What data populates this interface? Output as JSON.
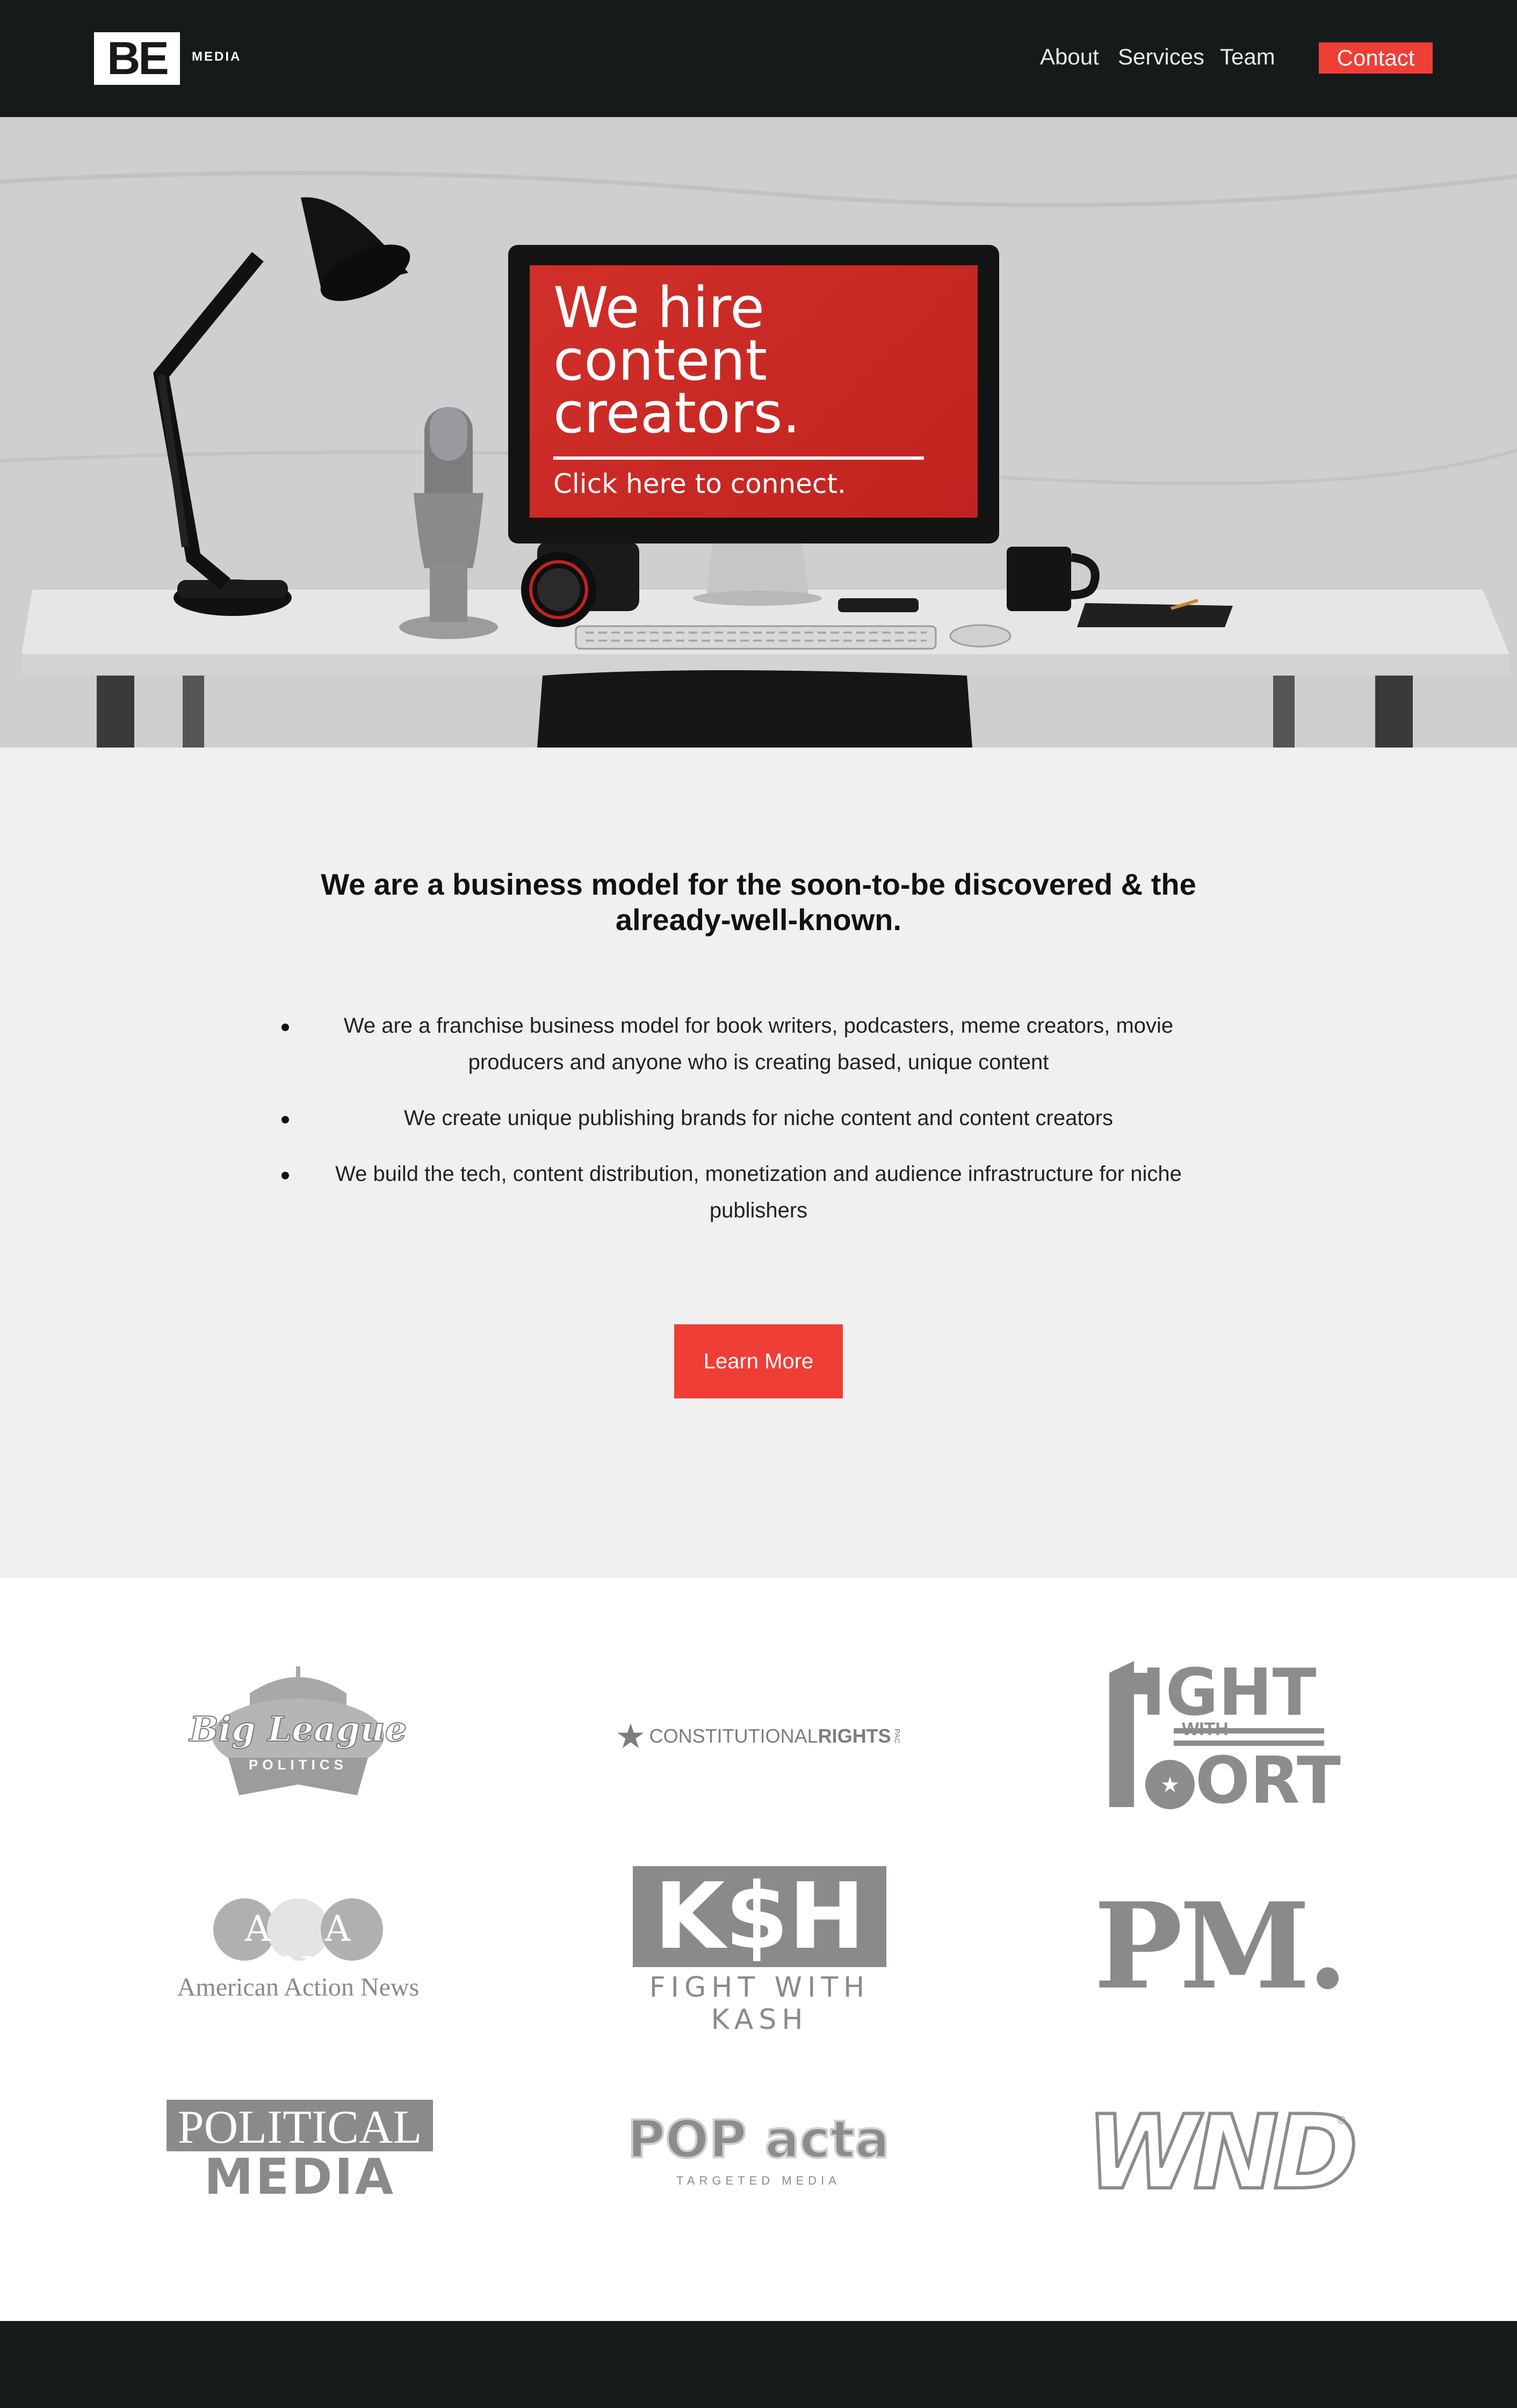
{
  "nav": {
    "logo_mark": "BE",
    "logo_sub": "MEDIA",
    "links": [
      "About",
      "Services",
      "Team"
    ],
    "contact_label": "Contact"
  },
  "hero": {
    "screen_title": "We hire content creators.",
    "screen_cta": "Click here to connect."
  },
  "intro": {
    "heading": "We are a business model for the soon-to-be discovered & the already-well-known.",
    "bullets": [
      "We are a franchise business model for book writers, podcasters, meme creators, movie producers and anyone who is creating based, unique content",
      "We create unique publishing brands for niche content and content creators",
      "We build the tech, content distribution, monetization and audience infrastructure for niche publishers"
    ],
    "button_label": "Learn More"
  },
  "logos": {
    "big_league_script": "Big League",
    "big_league_banner": "POLITICS",
    "constitutional_a": "CONSTITUTIONAL",
    "constitutional_b": "RIGHTS",
    "constitutional_c": "PAC",
    "fight_fort_top": "IGHT",
    "fight_fort_with": "WITH",
    "fight_fort_bottom": "ORT",
    "aan_letters": "A A N",
    "aan_name": "American Action News",
    "ksh_letters": "K$H",
    "ksh_sub": "FIGHT WITH KASH",
    "pm": "PM.",
    "political_top": "POLITICAL",
    "political_bottom": "MEDIA",
    "popacta_main": "POP acta",
    "popacta_sub": "TARGETED MEDIA",
    "wnd": "WND"
  },
  "colors": {
    "nav_bg": "#171a1a",
    "accent": "#ef3e36",
    "intro_bg": "#f0f0f0",
    "logo_gray": "#8a8a8a"
  }
}
